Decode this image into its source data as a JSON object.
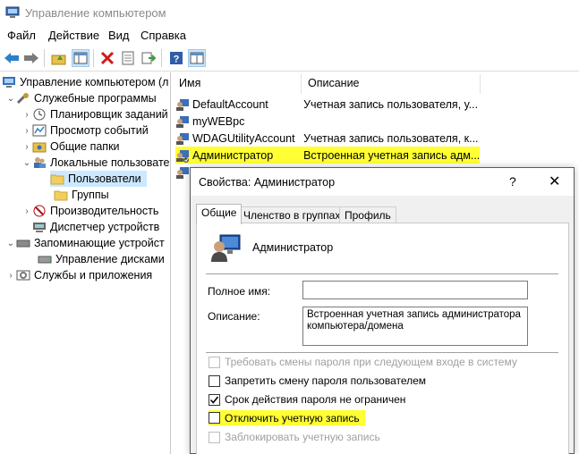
{
  "window": {
    "title": "Управление компьютером"
  },
  "menu": [
    "Файл",
    "Действие",
    "Вид",
    "Справка"
  ],
  "toolbar": [
    "back-arrow-icon",
    "forward-arrow-icon",
    "up-folder-icon",
    "show-tree-icon",
    "delete-icon",
    "properties-icon",
    "export-icon",
    "help-icon",
    "view-icon"
  ],
  "tree": [
    {
      "label": "Управление компьютером (л",
      "icon": "computer-icon"
    },
    {
      "label": "Служебные программы",
      "icon": "tools-icon"
    },
    {
      "label": "Планировщик заданий",
      "icon": "clock-icon"
    },
    {
      "label": "Просмотр событий",
      "icon": "event-viewer-icon"
    },
    {
      "label": "Общие папки",
      "icon": "shared-folder-icon"
    },
    {
      "label": "Локальные пользовате",
      "icon": "users-icon"
    },
    {
      "label": "Пользователи",
      "icon": "folder-icon"
    },
    {
      "label": "Группы",
      "icon": "folder-icon"
    },
    {
      "label": "Производительность",
      "icon": "performance-icon"
    },
    {
      "label": "Диспетчер устройств",
      "icon": "device-manager-icon"
    },
    {
      "label": "Запоминающие устройст",
      "icon": "storage-icon"
    },
    {
      "label": "Управление дисками",
      "icon": "disk-icon"
    },
    {
      "label": "Службы и приложения",
      "icon": "services-icon"
    }
  ],
  "list": {
    "columns": [
      "Имя",
      "Описание"
    ],
    "rows": [
      {
        "name": "DefaultAccount",
        "desc": "Учетная запись пользователя, у..."
      },
      {
        "name": "myWEBpc",
        "desc": ""
      },
      {
        "name": "WDAGUtilityAccount",
        "desc": "Учетная запись пользователя, к..."
      },
      {
        "name": "Администратор",
        "desc": "Встроенная учетная запись адм..."
      }
    ]
  },
  "dialog": {
    "title": "Свойства: Администратор",
    "help": "?",
    "close": "✕",
    "tabs": [
      "Общие",
      "Членство в группах",
      "Профиль"
    ],
    "username": "Администратор",
    "fullname_label": "Полное имя:",
    "fullname_value": "",
    "description_label": "Описание:",
    "description_value": "Встроенная учетная запись администратора компьютера/домена",
    "checkboxes": [
      {
        "label": "Требовать смены пароля при следующем входе в систему",
        "checked": false,
        "disabled": true
      },
      {
        "label": "Запретить смену пароля пользователем",
        "checked": false,
        "disabled": false
      },
      {
        "label": "Срок действия пароля не ограничен",
        "checked": true,
        "disabled": false
      },
      {
        "label": "Отключить учетную запись",
        "checked": false,
        "disabled": false
      },
      {
        "label": "Заблокировать учетную запись",
        "checked": false,
        "disabled": true
      }
    ]
  },
  "colors": {
    "highlight": "#ffff33",
    "selection": "#cce8ff"
  }
}
